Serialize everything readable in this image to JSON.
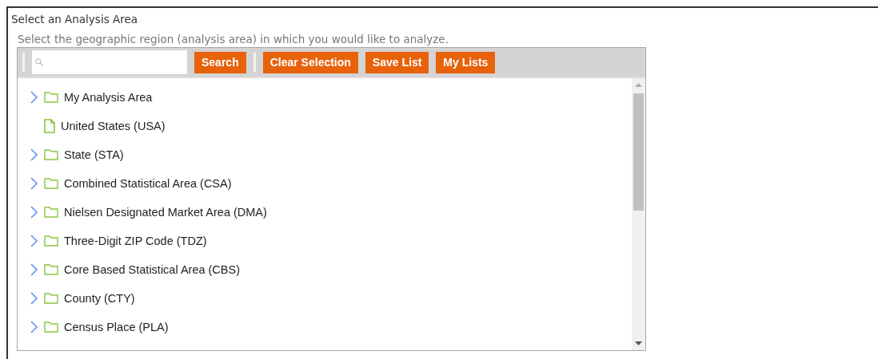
{
  "panel": {
    "title": "Select an Analysis Area",
    "description": "Select the geographic region (analysis area) in which you would like to analyze."
  },
  "toolbar": {
    "buttons": [
      "Search",
      "Clear Selection",
      "Save List",
      "My Lists"
    ]
  },
  "tree": {
    "items": [
      {
        "label": "My Analysis Area",
        "kind": "folder"
      },
      {
        "label": "United States (USA)",
        "kind": "file"
      },
      {
        "label": "State (STA)",
        "kind": "folder"
      },
      {
        "label": "Combined Statistical Area (CSA)",
        "kind": "folder"
      },
      {
        "label": "Nielsen Designated Market Area (DMA)",
        "kind": "folder"
      },
      {
        "label": "Three-Digit ZIP Code (TDZ)",
        "kind": "folder"
      },
      {
        "label": "Core Based Statistical Area (CBS)",
        "kind": "folder"
      },
      {
        "label": "County (CTY)",
        "kind": "folder"
      },
      {
        "label": "Census Place (PLA)",
        "kind": "folder"
      }
    ]
  }
}
